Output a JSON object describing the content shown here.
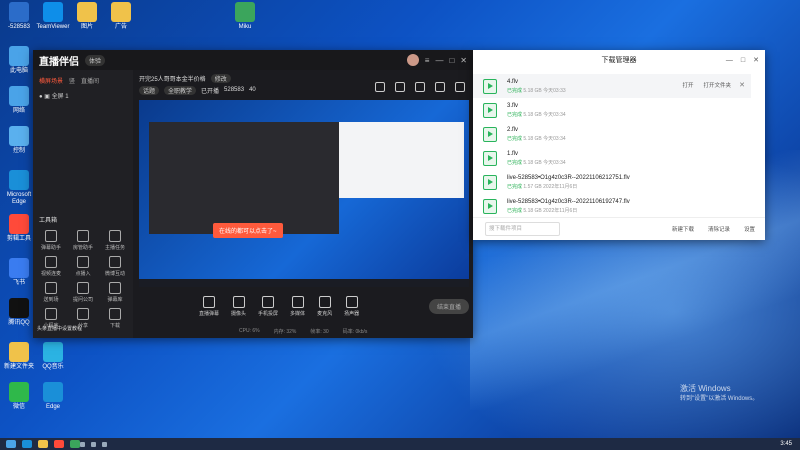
{
  "desktop": {
    "icons": [
      {
        "label": "-528583",
        "color": "#2b6cc9"
      },
      {
        "label": "TeamViewer",
        "color": "#0e8ee9"
      },
      {
        "label": "图片",
        "color": "#f0c24a"
      },
      {
        "label": "广告",
        "color": "#f0c24a"
      },
      {
        "label": "Miku",
        "color": "#3ba55c"
      },
      {
        "label": "此电脑",
        "color": "#4aa3e8"
      },
      {
        "label": "网络",
        "color": "#4aa3e8"
      },
      {
        "label": "控制",
        "color": "#5ab0ee"
      },
      {
        "label": "Microsoft Edge",
        "color": "#1a8fd8"
      },
      {
        "label": "剪辑工具",
        "color": "#ff4a3a"
      },
      {
        "label": "飞书",
        "color": "#3a7cf0"
      },
      {
        "label": "腾讯QQ",
        "color": "#111111"
      },
      {
        "label": "新建文件夹",
        "color": "#f0c24a"
      },
      {
        "label": "QQ音乐",
        "color": "#2bb3e3"
      },
      {
        "label": "微信",
        "color": "#2fb84a"
      },
      {
        "label": "Edge",
        "color": "#1a8fd8"
      }
    ]
  },
  "live_app": {
    "logo": "直播伴侣",
    "badge": "体验",
    "sidebar_tabs": [
      "横屏场景",
      "竖",
      "直播间"
    ],
    "active_tab_index": 0,
    "scene": "全屏 1",
    "tools_title": "工具箱",
    "tools": [
      "弹幕助手",
      "房管助手",
      "主播任务",
      "视频连麦",
      "点播入",
      "微博互动",
      "送到场",
      "提问公司",
      "弹幕库",
      "小程序",
      "分享",
      "下载"
    ],
    "side_bottom": "头条直播中设置教程",
    "stream_title": "开完25人哥哥本金半价格",
    "title_badge": "修改",
    "tags": [
      "话题",
      "全职教学",
      "已开播"
    ],
    "room_id": "528583",
    "viewers": "40",
    "toast": "在线的都可以点击了~",
    "bottom_buttons": [
      "直播弹幕",
      "摄像头",
      "手机投屏",
      "多媒体",
      "麦克风",
      "扬声器"
    ],
    "go_live": "结束直播",
    "status": [
      "CPU: 6%",
      "内存: 32%",
      "帧率: 30",
      "码率: 0kb/s"
    ],
    "accent": "#ff5a3c"
  },
  "download_manager": {
    "title": "下载管理器",
    "items": [
      {
        "name": "4.flv",
        "status": "已完成",
        "size": "5.18 GB",
        "time": "今天03:33"
      },
      {
        "name": "3.flv",
        "status": "已完成",
        "size": "5.18 GB",
        "time": "今天03:34"
      },
      {
        "name": "2.flv",
        "status": "已完成",
        "size": "5.18 GB",
        "time": "今天03:34"
      },
      {
        "name": "1.flv",
        "status": "已完成",
        "size": "5.18 GB",
        "time": "今天03:34"
      },
      {
        "name": "live-528583•O1g4z0c3R--20221106212751.flv",
        "status": "已完成",
        "size": "1.57 GB",
        "time": "2022年11月6日"
      },
      {
        "name": "live-528583•O1g4z0c3R--20221106192747.flv",
        "status": "已完成",
        "size": "5.18 GB",
        "time": "2022年11月6日"
      }
    ],
    "open_label": "打开",
    "open_folder_label": "打开文件夹",
    "search_placeholder": "搜下载件项目",
    "footer_buttons": [
      "新建下载",
      "清除记录",
      "设置"
    ]
  },
  "activation": {
    "title": "激活 Windows",
    "subtitle": "转到\"设置\"以激活 Windows。"
  },
  "taskbar": {
    "clock": "3:45"
  }
}
